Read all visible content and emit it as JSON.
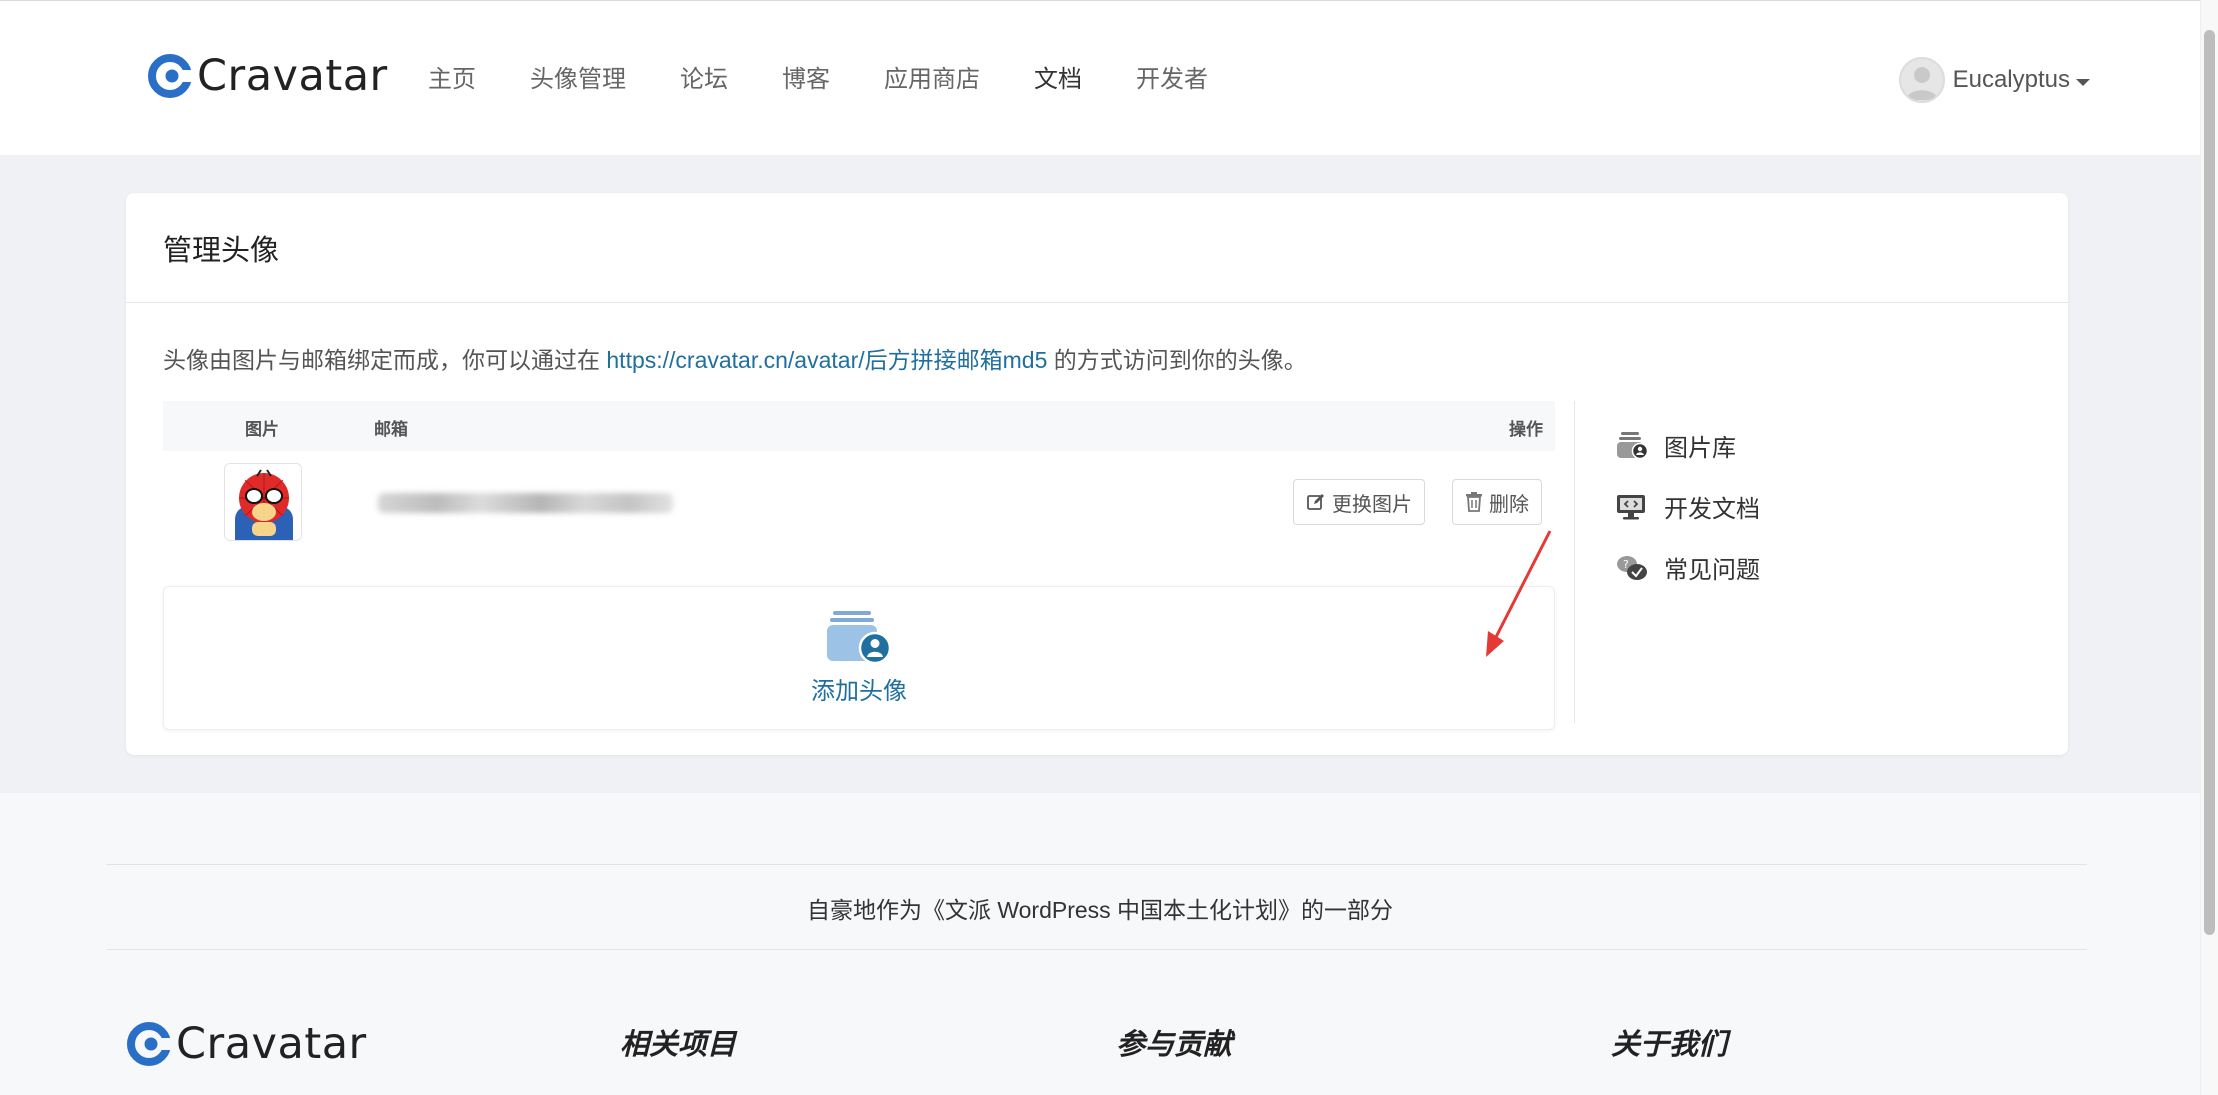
{
  "header": {
    "brand": "Cravatar",
    "nav": [
      {
        "label": "主页",
        "active": false
      },
      {
        "label": "头像管理",
        "active": false
      },
      {
        "label": "论坛",
        "active": false
      },
      {
        "label": "博客",
        "active": false
      },
      {
        "label": "应用商店",
        "active": false
      },
      {
        "label": "文档",
        "active": true
      },
      {
        "label": "开发者",
        "active": false
      }
    ],
    "user": {
      "name": "Eucalyptus"
    }
  },
  "card": {
    "title": "管理头像",
    "intro_prefix": "头像由图片与邮箱绑定而成，你可以通过在 ",
    "intro_link": "https://cravatar.cn/avatar/后方拼接邮箱md5",
    "intro_suffix": " 的方式访问到你的头像。",
    "table": {
      "col_image": "图片",
      "col_email": "邮箱",
      "col_actions": "操作",
      "rows": [
        {
          "email": "••••••••••••••••••••",
          "change_label": "更换图片",
          "delete_label": "删除"
        }
      ]
    },
    "add_label": "添加头像",
    "side_menu": [
      {
        "label": "图片库",
        "icon": "image-library-icon"
      },
      {
        "label": "开发文档",
        "icon": "dev-docs-icon"
      },
      {
        "label": "常见问题",
        "icon": "faq-icon"
      }
    ]
  },
  "footer": {
    "proud_text": "自豪地作为《文派 WordPress 中国本土化计划》的一部分",
    "brand": "Cravatar",
    "columns": [
      "相关项目",
      "参与贡献",
      "关于我们"
    ]
  },
  "colors": {
    "brand_blue": "#2a6fc7",
    "link": "#1f6f9f",
    "annotation": "#e53935"
  }
}
